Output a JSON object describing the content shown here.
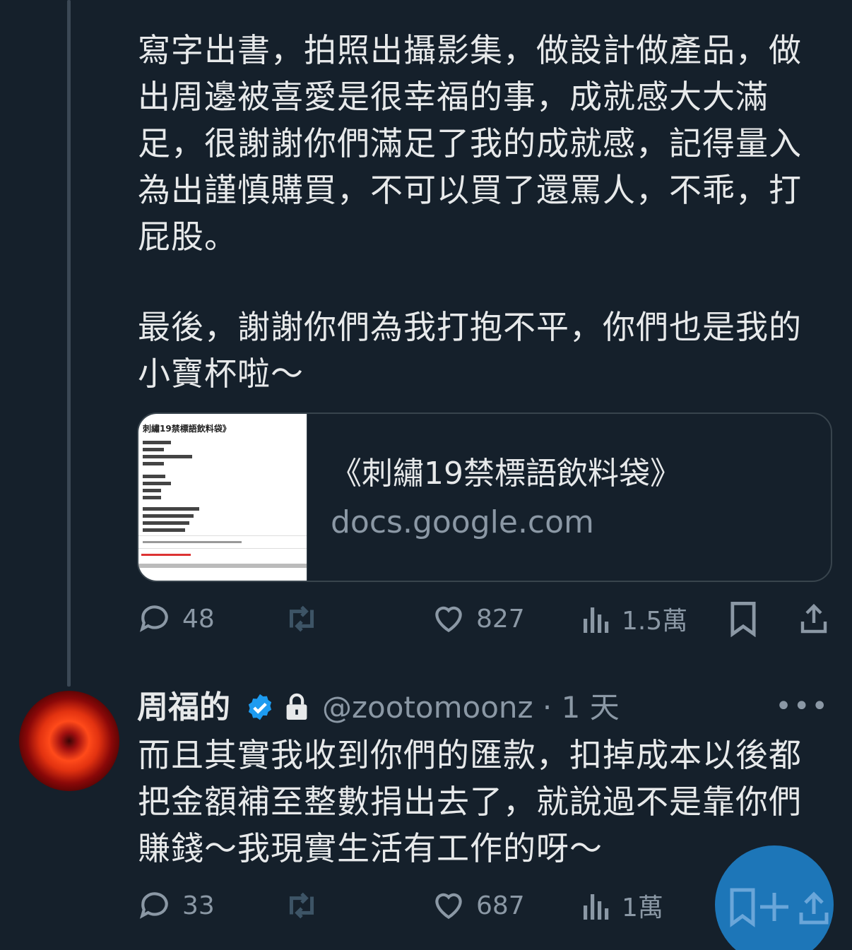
{
  "tweet1": {
    "body": "寫字出書，拍照出攝影集，做設計做產品，做\n出周邊被喜愛是很幸福的事，成就感大大滿\n足，很謝謝你們滿足了我的成就感，記得量入\n為出謹慎購買，不可以買了還罵人，不乖，打\n屁股。",
    "body2": "最後，謝謝你們為我打抱不平，你們也是我的\n小寶杯啦～",
    "card": {
      "title": "《刺繡19禁標語飲料袋》",
      "domain": "docs.google.com",
      "thumb_title": "刺繡19禁標語飲料袋》"
    },
    "actions": {
      "replies": "48",
      "likes": "827",
      "views": "1.5萬"
    }
  },
  "tweet2": {
    "name": "周福的",
    "handle": "@zootomoonz · 1 天",
    "body": "而且其實我收到你們的匯款，扣掉成本以後都\n把金額補至整數捐出去了，就說過不是靠你們\n賺錢～我現實生活有工作的呀～",
    "actions": {
      "replies": "33",
      "likes": "687",
      "views": "1萬"
    }
  },
  "icons": {
    "verified": "verified-badge-icon",
    "lock": "lock-icon",
    "more": "more-dots-icon",
    "fab": "compose-icon"
  },
  "colors": {
    "background": "#15202b",
    "text": "#e7e9ea",
    "muted": "#8b98a5",
    "verified": "#1d9bf0",
    "fab": "#1d76b8"
  }
}
